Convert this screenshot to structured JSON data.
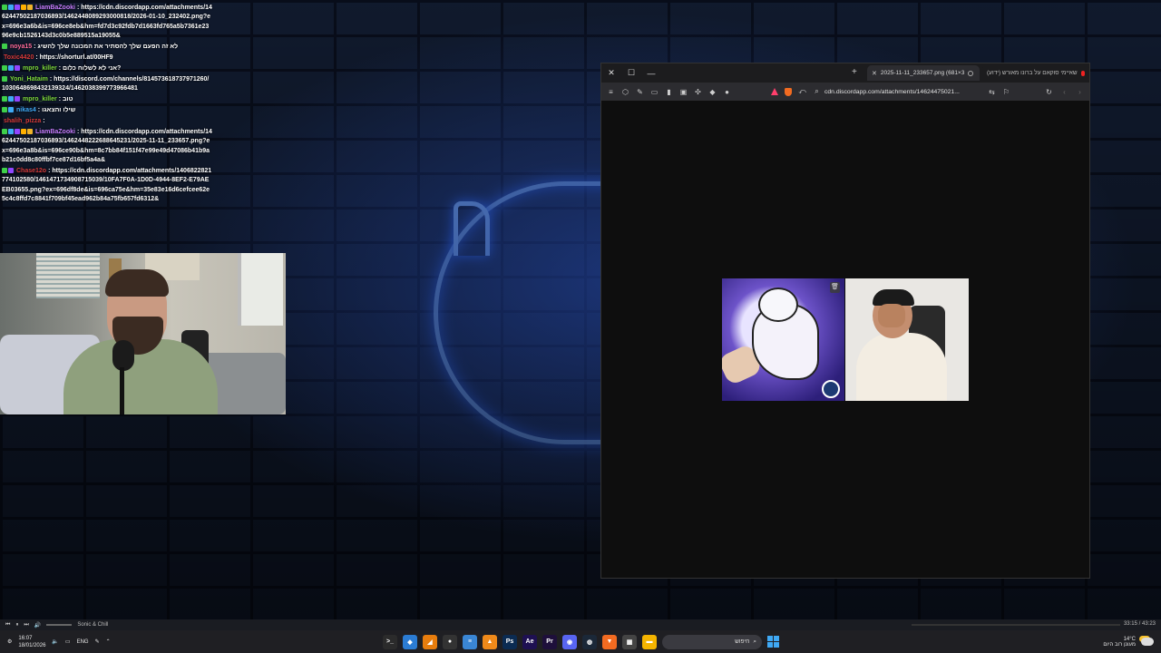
{
  "chat": [
    {
      "user": "LiamBaZooki",
      "color": "#c77dff",
      "badges": [
        "#3ecf4a",
        "#3fa9f5",
        "#9146ff",
        "#ffb000",
        "#f0b429"
      ],
      "text": "https://cdn.discordapp.com/attachments/1462447502187036893/1462448089293000818/2026-01-10_232402.png?ex=696e3a6b&is=696ce8eb&hm=fd7d3c92fdb7d1663fd765a5b7361e2396e9cb1526143d3c0b5e889515a19055&"
    },
    {
      "user": "noya15",
      "color": "#ff6b9a",
      "badges": [
        "#3ecf4a"
      ],
      "text": "לא זה הפעם שלך להסתיר את המכונה שלך להשיג"
    },
    {
      "user": "Toxic4420",
      "color": "#d63a3a",
      "badges": [],
      "text": "https://shorturl.at/00HF9"
    },
    {
      "user": "mpro_killer",
      "color": "#7dd93b",
      "badges": [
        "#3ecf4a",
        "#3fa9f5",
        "#9146ff"
      ],
      "text": "אני לא לשלוח כלום?"
    },
    {
      "user": "Yoni_Hataim",
      "color": "#7dd93b",
      "badges": [
        "#3ecf4a"
      ],
      "text": "https://discord.com/channels/814573618737971260/1030648698432139324/1462038399773966481"
    },
    {
      "user": "mpro_killer",
      "color": "#7dd93b",
      "badges": [
        "#3ecf4a",
        "#3fa9f5",
        "#9146ff"
      ],
      "text": "טוב"
    },
    {
      "user": "nikas4",
      "color": "#3fa9f5",
      "badges": [
        "#3ecf4a",
        "#3fa9f5"
      ],
      "text": "שילו והצאגו"
    },
    {
      "user": "shalih_pizza",
      "color": "#d63a3a",
      "badges": [],
      "text": ""
    },
    {
      "user": "LiamBaZooki",
      "color": "#c77dff",
      "badges": [
        "#3ecf4a",
        "#3fa9f5",
        "#9146ff",
        "#ffb000",
        "#f0b429"
      ],
      "text": "https://cdn.discordapp.com/attachments/1462447502187036893/1462448222688645231/2025-11-11_233657.png?ex=696e3a8b&is=696ce90b&hm=8c7bb84f151f47e99e49d47086b41b9ab21c0dd8c80ffbf7ce87d16bf5a4a&"
    },
    {
      "user": "Chase12o",
      "color": "#d63a3a",
      "badges": [
        "#3ecf4a",
        "#9146ff"
      ],
      "text": "https://cdn.discordapp.com/attachments/1406822821774102580/1461471734908715039/10FA7F0A-1D0D-4944-8EF2-E79AEEB03655.png?ex=696df8de&is=696ca75e&hm=35e83e16d6cefcee62e5c4c8ffd7c8841f709bf45ead962b84a75fb657fd6312&"
    }
  ],
  "browser": {
    "window_controls": {
      "close": "✕",
      "maximize": "☐",
      "minimize": "—"
    },
    "new_tab": "+",
    "active_tab": "2025-11-11_233657.png (681×3",
    "inactive_tab": "(ידוע) שאיימי סוקאם על ברונו מאורש",
    "url": "cdn.discordapp.com/attachments/14624475021...",
    "trash_icon": "🗑"
  },
  "mediabar": {
    "title": "Sonic & Chill",
    "time": "33:15 / 43:23"
  },
  "taskbar": {
    "clock_time": "16:07",
    "clock_date": "18/01/2026",
    "lang": "ENG",
    "search_placeholder": "חיפוש",
    "weather_temp": "14°C",
    "weather_text": "מעונן רוב היום",
    "apps": [
      {
        "name": "terminal-app",
        "color": "#2b2b2b",
        "glyph": ">_"
      },
      {
        "name": "vscode-app",
        "color": "#2b7cd3",
        "glyph": "◆"
      },
      {
        "name": "blender-app",
        "color": "#e87d0d",
        "glyph": "◢"
      },
      {
        "name": "github-app",
        "color": "#333",
        "glyph": "●"
      },
      {
        "name": "notes-app",
        "color": "#3a86d4",
        "glyph": "≡"
      },
      {
        "name": "vlc-app",
        "color": "#f08a1a",
        "glyph": "▲"
      },
      {
        "name": "photoshop-app",
        "color": "#0b2b52",
        "glyph": "Ps"
      },
      {
        "name": "aftereffects-app",
        "color": "#1e1052",
        "glyph": "Ae"
      },
      {
        "name": "premiere-app",
        "color": "#1e0f3b",
        "glyph": "Pr"
      },
      {
        "name": "discord-app",
        "color": "#5865f2",
        "glyph": "◉"
      },
      {
        "name": "steam-app",
        "color": "#1b2838",
        "glyph": "◍"
      },
      {
        "name": "brave-app",
        "color": "#f26b21",
        "glyph": "▼"
      },
      {
        "name": "calendar-app",
        "color": "#444",
        "glyph": "▦"
      },
      {
        "name": "explorer-app",
        "color": "#f4b400",
        "glyph": "▬"
      }
    ]
  }
}
